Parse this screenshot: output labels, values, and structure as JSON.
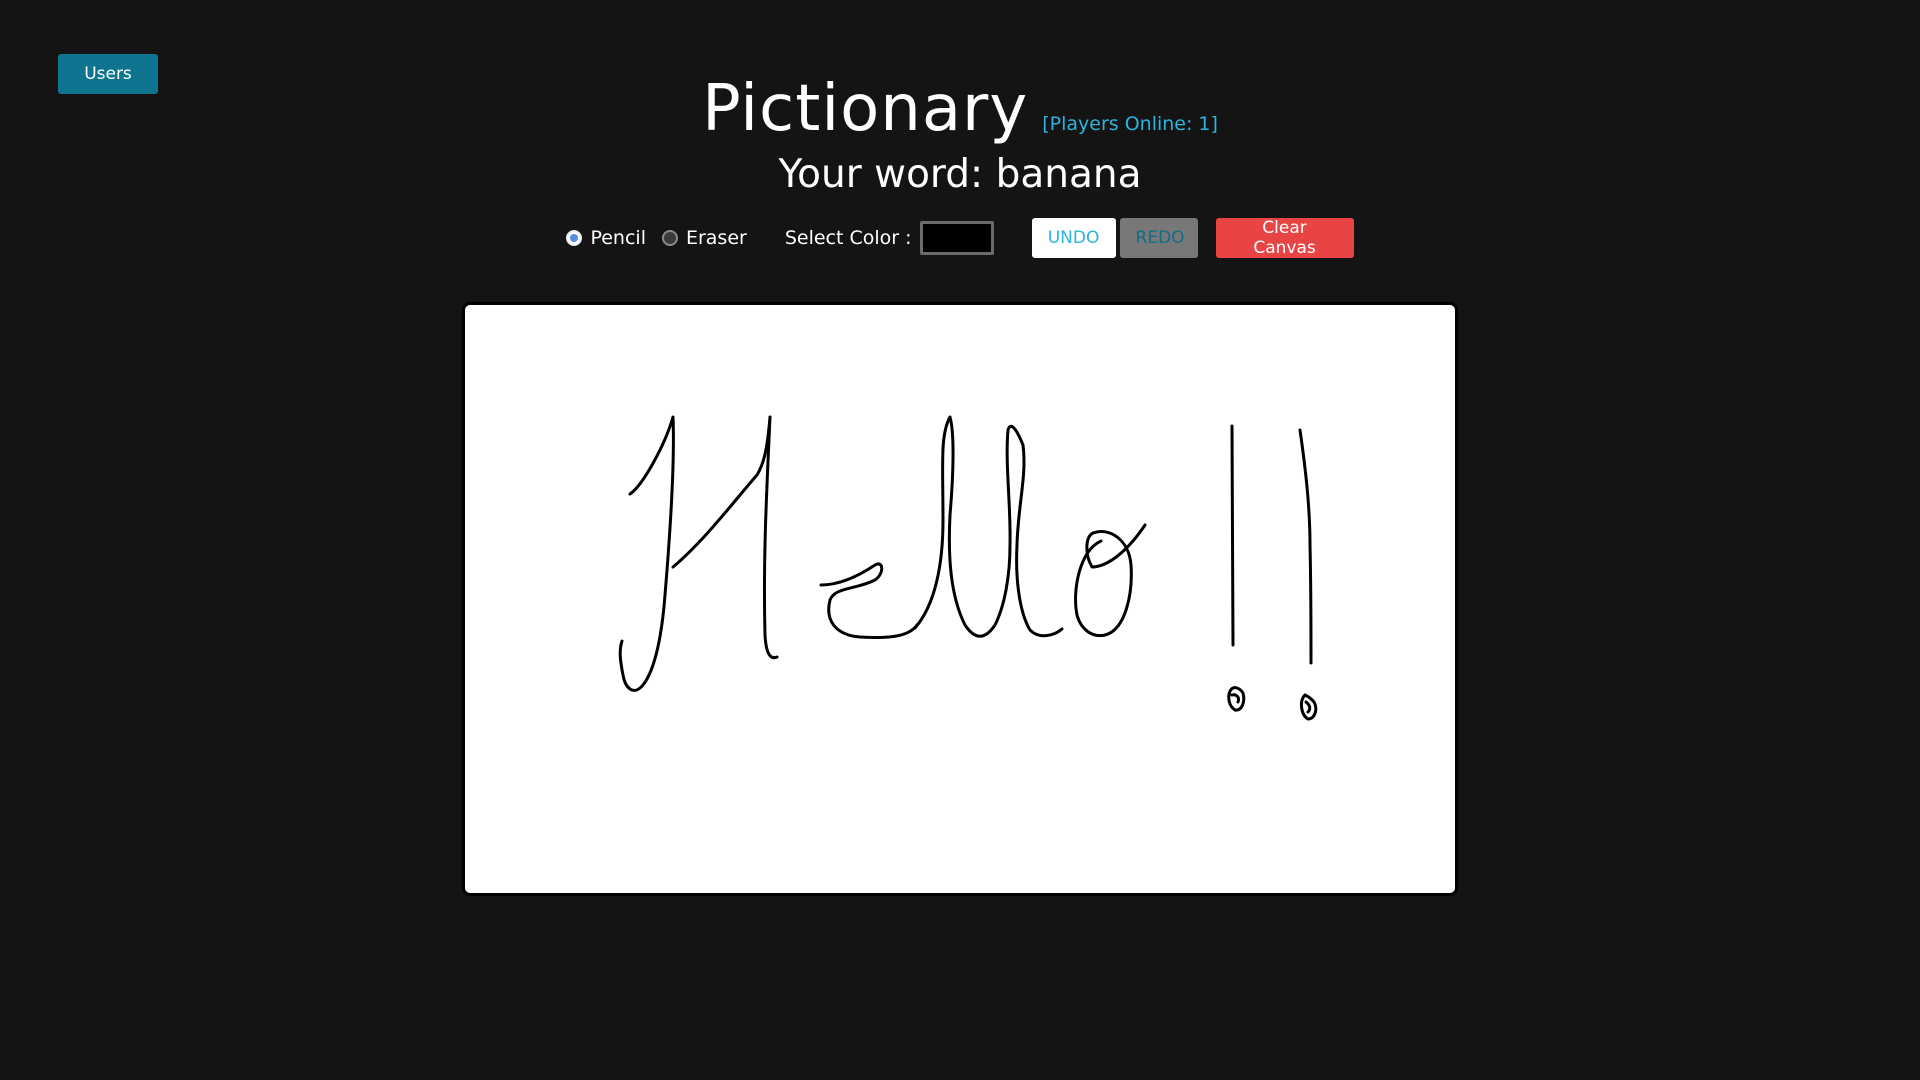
{
  "nav": {
    "users_label": "Users"
  },
  "header": {
    "title": "Pictionary",
    "players_online": "[Players Online: 1]",
    "word_prefix": "Your word:",
    "word": "banana"
  },
  "toolbar": {
    "tools": [
      {
        "label": "Pencil",
        "selected": true
      },
      {
        "label": "Eraser",
        "selected": false
      }
    ],
    "color_label": "Select Color :",
    "selected_color": "#000000",
    "undo_label": "UNDO",
    "redo_label": "REDO",
    "clear_label": "Clear Canvas"
  },
  "canvas": {
    "stroke_color": "#000000"
  }
}
